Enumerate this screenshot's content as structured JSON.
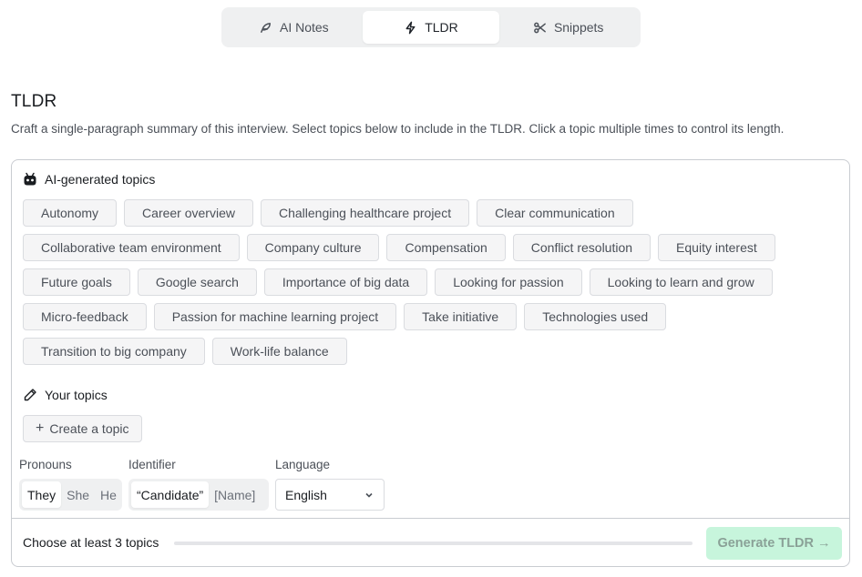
{
  "tabs": [
    {
      "label": "AI Notes",
      "icon": "feather-icon",
      "active": false
    },
    {
      "label": "TLDR",
      "icon": "lightning-icon",
      "active": true
    },
    {
      "label": "Snippets",
      "icon": "scissors-icon",
      "active": false
    }
  ],
  "page": {
    "title": "TLDR",
    "description": "Craft a single-paragraph summary of this interview. Select topics below to include in the TLDR. Click a topic multiple times to control its length."
  },
  "ai_topics": {
    "heading": "AI-generated topics",
    "rows": [
      [
        "Autonomy",
        "Career overview",
        "Challenging healthcare project",
        "Clear communication"
      ],
      [
        "Collaborative team environment",
        "Company culture",
        "Compensation",
        "Conflict resolution",
        "Equity interest"
      ],
      [
        "Future goals",
        "Google search",
        "Importance of big data",
        "Looking for passion",
        "Looking to learn and grow"
      ],
      [
        "Micro-feedback",
        "Passion for machine learning project",
        "Take initiative",
        "Technologies used"
      ],
      [
        "Transition to big company",
        "Work-life balance"
      ]
    ]
  },
  "your_topics": {
    "heading": "Your topics",
    "create_label": "Create a topic"
  },
  "options": {
    "pronouns": {
      "label": "Pronouns",
      "items": [
        "They",
        "She",
        "He"
      ],
      "selected": "They"
    },
    "identifier": {
      "label": "Identifier",
      "items": [
        "“Candidate”",
        "[Name]"
      ],
      "selected": "“Candidate”"
    },
    "language": {
      "label": "Language",
      "value": "English"
    }
  },
  "footer": {
    "status": "Choose at least 3 topics",
    "progress": 0,
    "generate_label": "Generate TLDR →"
  },
  "colors": {
    "accent_disabled": "#c7f5dc",
    "accent_text_disabled": "#8aa197"
  }
}
